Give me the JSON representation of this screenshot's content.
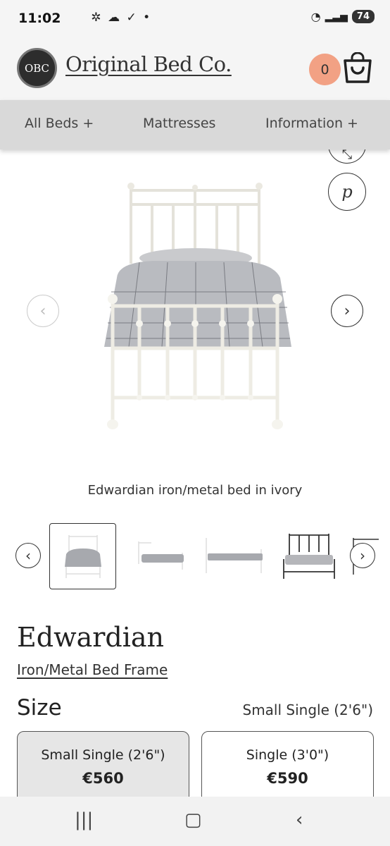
{
  "status_bar": {
    "time": "11:02",
    "battery": "74"
  },
  "header": {
    "logo_text": "OBC",
    "brand": "Original Bed Co.",
    "cart_count": "0"
  },
  "nav": {
    "items": [
      "All Beds  +",
      "Mattresses",
      "Information  +"
    ]
  },
  "share": {
    "pinterest_label": "p"
  },
  "gallery": {
    "caption": "Edwardian iron/metal bed in ivory",
    "thumbnail_count": 5,
    "selected_index": 0
  },
  "product": {
    "title": "Edwardian",
    "subtitle": "Iron/Metal Bed Frame",
    "size_label": "Size",
    "size_selected": "Small Single (2'6\")",
    "sizes": [
      {
        "name": "Small Single (2'6\")",
        "price": "€560"
      },
      {
        "name": "Single (3'0\")",
        "price": "€590"
      }
    ]
  },
  "colors": {
    "accent": "#f2a184",
    "nav_bg": "#d9d9d9",
    "bed_ivory": "#f3f2ec"
  }
}
